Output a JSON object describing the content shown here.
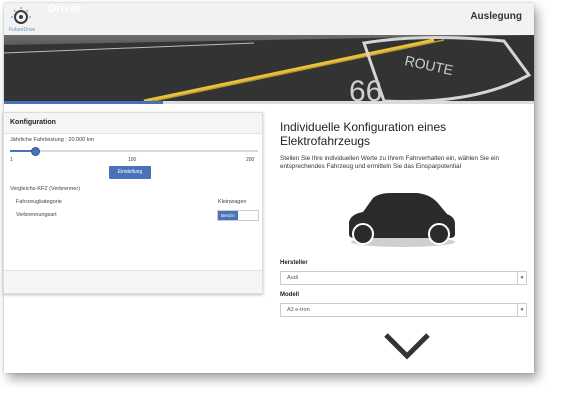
{
  "header": {
    "logo_text": "FutureDrive",
    "tab_label": "Driver",
    "page_title": "Auslegung"
  },
  "progress": {
    "fraction": 0.3
  },
  "left_panel": {
    "title": "Konfiguration",
    "mileage_label": "Jährliche Fahrleistung : 20.000 km",
    "slider": {
      "min_label": "1",
      "mid_label": "100",
      "max_label": "200",
      "value": 20,
      "max": 200
    },
    "compare_heading": "Vergleichs-KFZ (Verbrenner)",
    "category_label": "Fahrzeugkategorie",
    "category_value": "Kleinwagen",
    "fuel_label": "Verbrennungsart",
    "fuel_value": "Benzin",
    "settings_button": "Einstellung"
  },
  "main": {
    "title": "Individuelle Konfiguration eines Elektrofahrzeugs",
    "description": "Stellen Sie Ihre individuellen Werte zu Ihrem Fahrverhalten ein, wählen Sie ein entsprechendes Fahrzeug und ermitteln Sie das Einsparpotential",
    "manufacturer_label": "Hersteller",
    "manufacturer_value": "Audi",
    "model_label": "Modell",
    "model_value": "A3 e-tron"
  },
  "colors": {
    "accent": "#4a72b8",
    "banner": "#2a2a2a",
    "road_line": "#e8c13a"
  },
  "icons": {
    "logo": "gauge-logo-icon",
    "car": "car-silhouette-icon",
    "scroll": "chevron-down-icon"
  }
}
